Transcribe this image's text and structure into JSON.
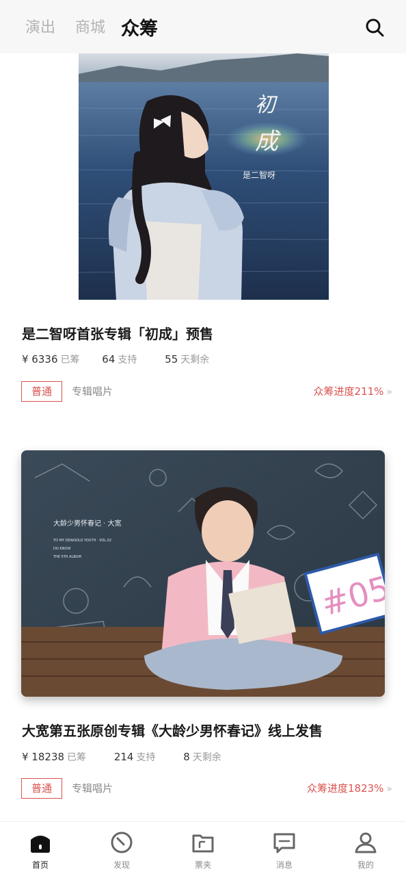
{
  "topnav": {
    "tabs": [
      {
        "label": "演出"
      },
      {
        "label": "商城"
      },
      {
        "label": "众筹"
      }
    ],
    "active_tab": "众筹",
    "search_icon": "search-icon"
  },
  "projects": [
    {
      "cover_text": {
        "line1": "初",
        "line2": "成",
        "artist": "是二智呀"
      },
      "title": "是二智呀首张专辑「初成」预售",
      "raised_amount": "¥ 6336",
      "raised_label": "已筹",
      "supporters": "64",
      "supporters_label": "支持",
      "days_left": "55",
      "days_left_label": "天剩余",
      "tag": "普通",
      "category": "专辑唱片",
      "progress": "众筹进度211%",
      "progress_chevron": "»"
    },
    {
      "cover_text": {
        "title": "大龄少男怀春记 · 大宽",
        "line2": "TO MY DEARIOLD YOUTH · VOL.02",
        "line3": "DO KNOW",
        "line4": "THE 5TH ALBUM",
        "badge": "#05"
      },
      "title": "大宽第五张原创专辑《大龄少男怀春记》线上发售",
      "raised_amount": "¥ 18238",
      "raised_label": "已筹",
      "supporters": "214",
      "supporters_label": "支持",
      "days_left": "8",
      "days_left_label": "天剩余",
      "tag": "普通",
      "category": "专辑唱片",
      "progress": "众筹进度1823%",
      "progress_chevron": "»"
    }
  ],
  "bottomnav": {
    "items": [
      {
        "label": "首页",
        "icon": "home-icon"
      },
      {
        "label": "发现",
        "icon": "compass-icon"
      },
      {
        "label": "票夹",
        "icon": "ticket-folder-icon"
      },
      {
        "label": "消息",
        "icon": "message-icon"
      },
      {
        "label": "我的",
        "icon": "profile-icon"
      }
    ],
    "active": "首页"
  },
  "colors": {
    "accent": "#d9534f",
    "muted": "#9a9a9a"
  }
}
